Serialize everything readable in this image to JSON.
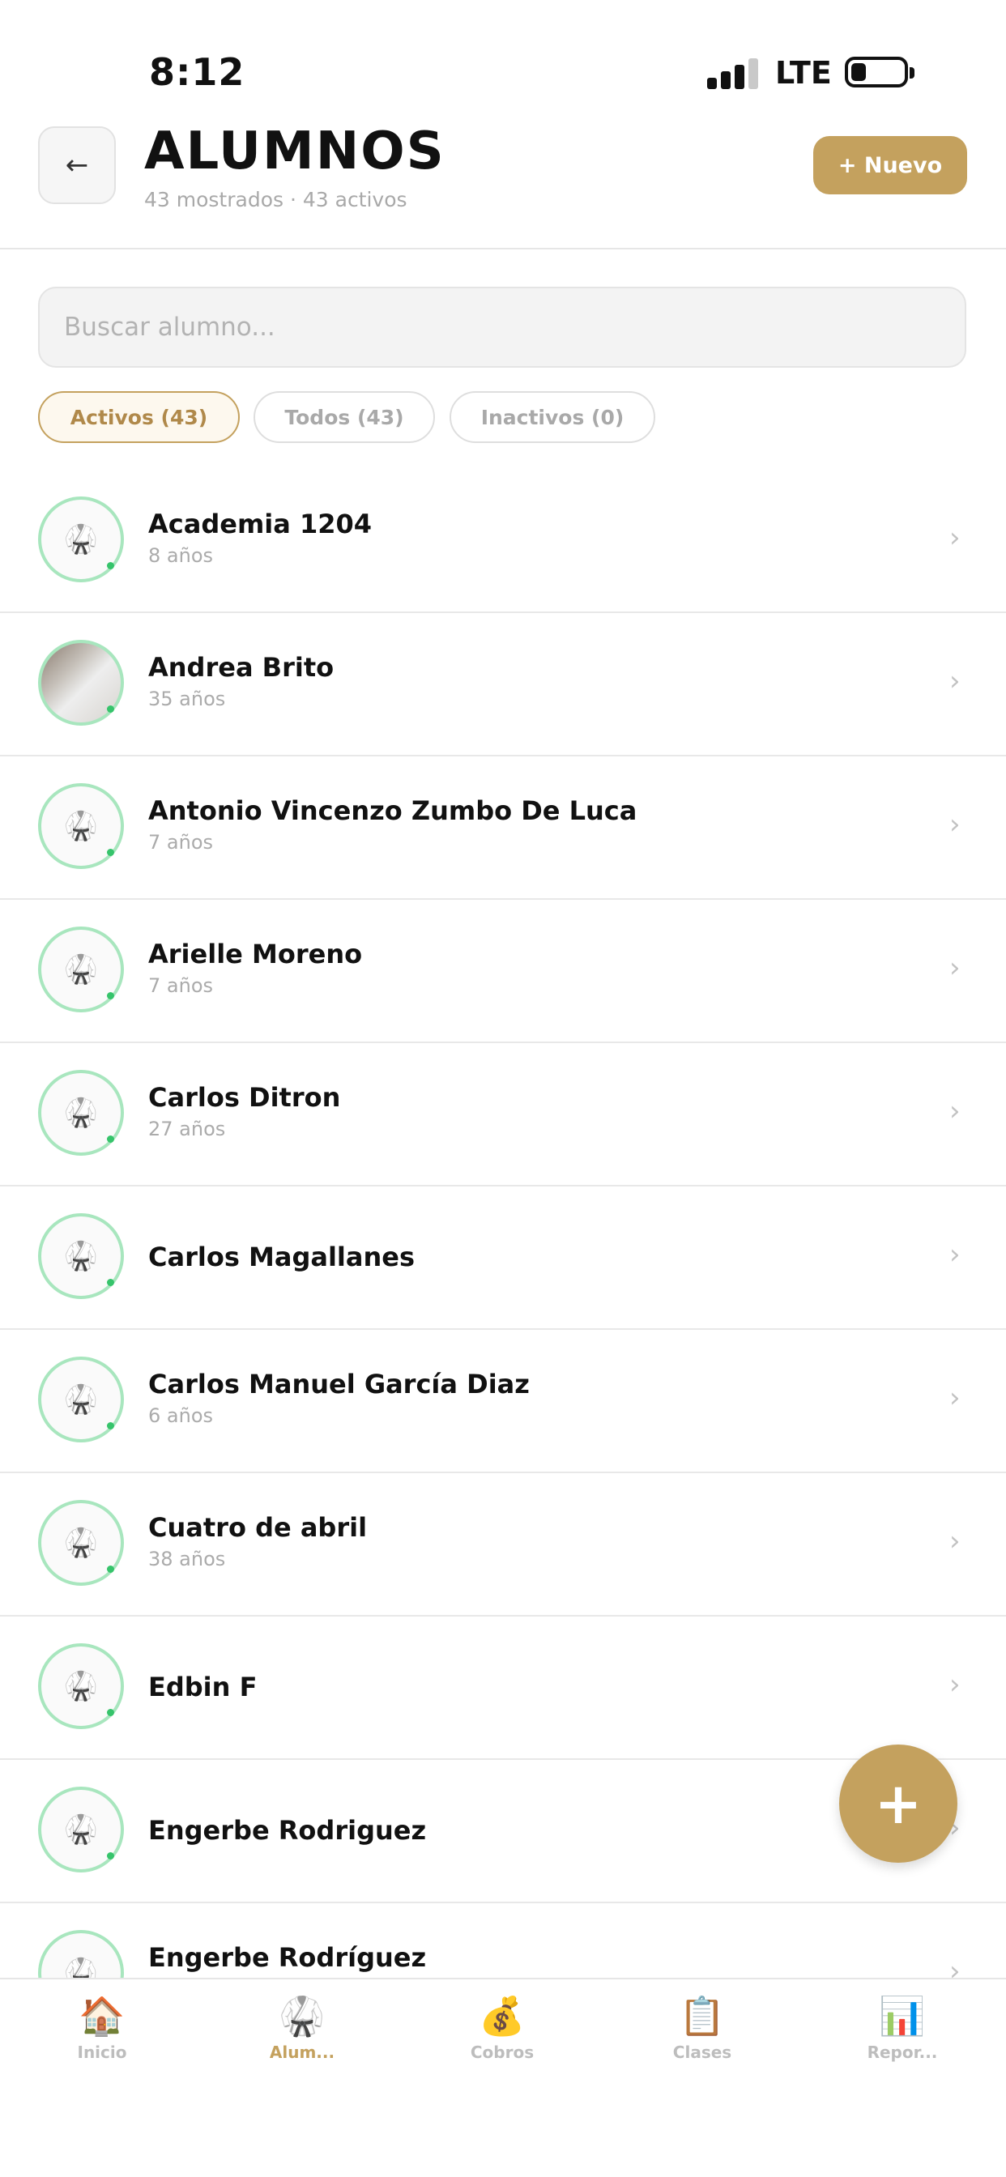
{
  "status_bar": {
    "time": "8:12",
    "network": "LTE"
  },
  "header": {
    "back_icon": "←",
    "title": "ALUMNOS",
    "subtitle": "43 mostrados · 43 activos",
    "new_button": "+ Nuevo"
  },
  "search": {
    "placeholder": "Buscar alumno..."
  },
  "filters": [
    {
      "label": "Activos (43)",
      "active": true
    },
    {
      "label": "Todos (43)",
      "active": false
    },
    {
      "label": "Inactivos (0)",
      "active": false
    }
  ],
  "students": [
    {
      "name": "Academia 1204",
      "age": "8 años"
    },
    {
      "name": "Andrea Brito",
      "age": "35 años"
    },
    {
      "name": "Antonio Vincenzo Zumbo De Luca",
      "age": "7 años"
    },
    {
      "name": "Arielle Moreno",
      "age": "7 años"
    },
    {
      "name": "Carlos Ditron",
      "age": "27 años"
    },
    {
      "name": "Carlos Magallanes",
      "age": ""
    },
    {
      "name": "Carlos Manuel García Diaz",
      "age": "6 años"
    },
    {
      "name": "Cuatro de abril",
      "age": "38 años"
    },
    {
      "name": "Edbin F",
      "age": ""
    },
    {
      "name": "Engerbe Rodriguez",
      "age": ""
    },
    {
      "name": "Engerbe Rodríguez",
      "age": ""
    }
  ],
  "icons": {
    "gi": "🥋",
    "chevron": "›",
    "fab": "+"
  },
  "tabs": [
    {
      "label": "Inicio",
      "icon": "🏠"
    },
    {
      "label": "Alum...",
      "icon": "🥋"
    },
    {
      "label": "Cobros",
      "icon": "💰"
    },
    {
      "label": "Clases",
      "icon": "📋"
    },
    {
      "label": "Repor...",
      "icon": "📊"
    }
  ],
  "colors": {
    "accent": "#c4a15e",
    "avatar_ring": "#a8e6be",
    "status_dot": "#36c46b"
  }
}
